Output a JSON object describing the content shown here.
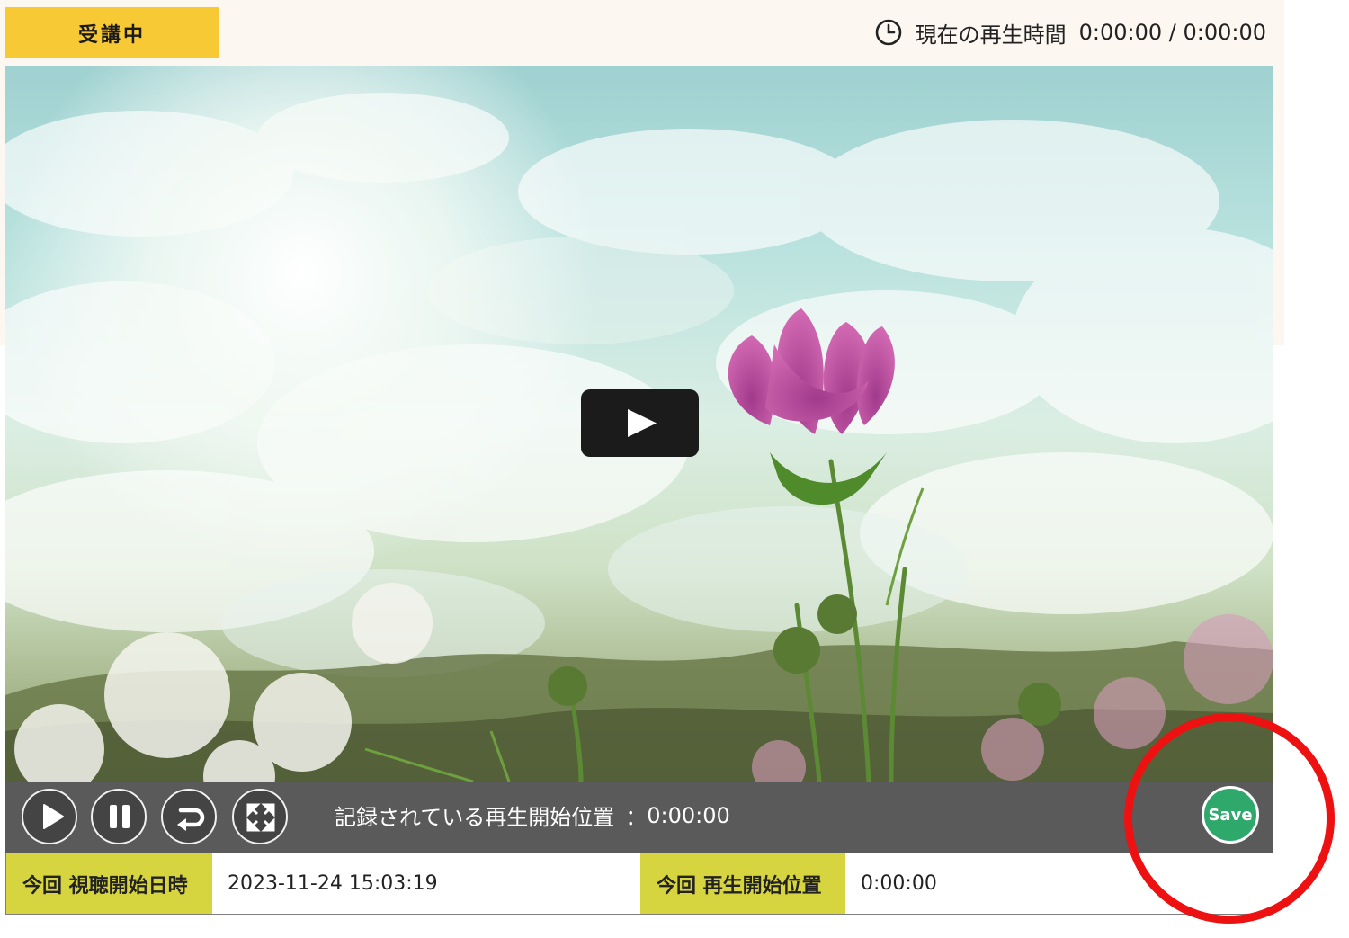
{
  "header": {
    "status_badge": "受講中",
    "current_time_label": "現在の再生時間",
    "current_time_value": "0:00:00 / 0:00:00",
    "clock_icon": "clock-icon"
  },
  "video": {
    "thumbnail_icon": "cosmos-flower-sky-thumbnail",
    "play_overlay_icon": "play-icon"
  },
  "controls": {
    "play_icon": "play-icon",
    "pause_icon": "pause-icon",
    "restart_icon": "restart-icon",
    "fullscreen_icon": "fullscreen-icon",
    "recorded_label": "記録されている再生開始位置",
    "recorded_separator": "：",
    "recorded_value": "0:00:00",
    "save_label": "Save"
  },
  "info": {
    "view_start_label": "今回 視聴開始日時",
    "view_start_value": "2023-11-24 15:03:19",
    "play_start_label": "今回 再生開始位置",
    "play_start_value": "0:00:00"
  },
  "colors": {
    "badge": "#f7c935",
    "control_bar": "#5a5a5a",
    "save": "#2fa86b",
    "info_label": "#d6d43f",
    "highlight": "#ee1111"
  }
}
